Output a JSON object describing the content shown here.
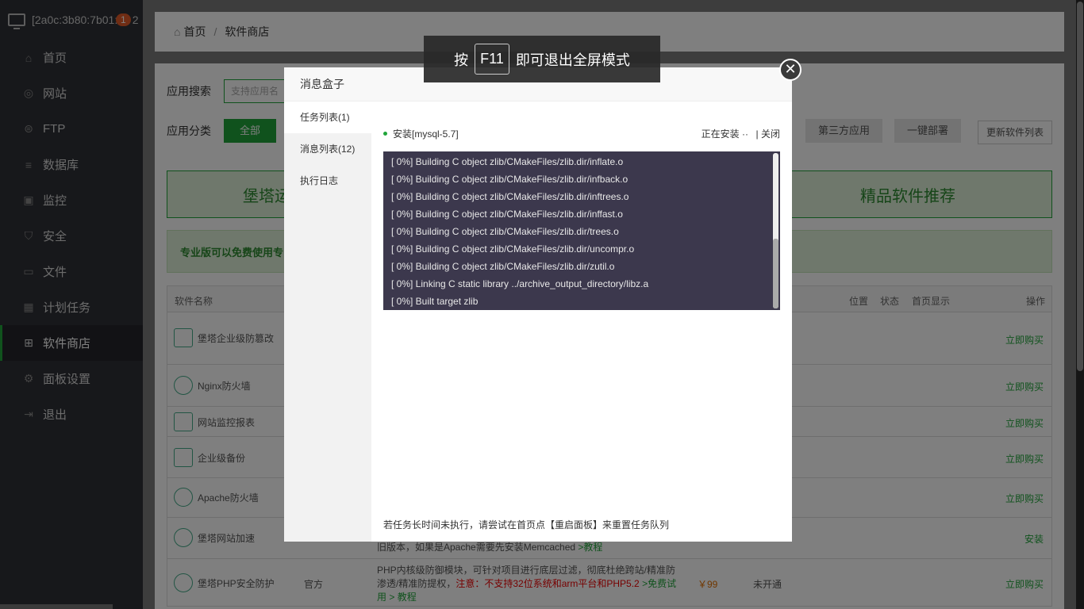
{
  "sidebar": {
    "server_name": "[2a0c:3b80:7b01:3",
    "server_suffix": "2",
    "notice_count": "1",
    "items": [
      {
        "label": "首页",
        "icon": "home-icon"
      },
      {
        "label": "网站",
        "icon": "globe-icon"
      },
      {
        "label": "FTP",
        "icon": "ftp-icon"
      },
      {
        "label": "数据库",
        "icon": "database-icon"
      },
      {
        "label": "监控",
        "icon": "monitor-icon"
      },
      {
        "label": "安全",
        "icon": "shield-icon"
      },
      {
        "label": "文件",
        "icon": "folder-icon"
      },
      {
        "label": "计划任务",
        "icon": "calendar-icon"
      },
      {
        "label": "软件商店",
        "icon": "grid-icon"
      },
      {
        "label": "面板设置",
        "icon": "gear-icon"
      },
      {
        "label": "退出",
        "icon": "logout-icon"
      }
    ]
  },
  "breadcrumb": {
    "home": "首页",
    "sep": "/",
    "current": "软件商店"
  },
  "store": {
    "search_label": "应用搜索",
    "search_placeholder": "支持应用名",
    "category_label": "应用分类",
    "category_all": "全部",
    "category_third": "第三方应用",
    "category_deploy": "一键部署",
    "update_btn": "更新软件列表",
    "banner_left": "堡塔运",
    "banner_right": "精品软件推荐",
    "tip": "专业版可以免费使用专"
  },
  "table": {
    "headers": {
      "name": "软件名称",
      "position": "位置",
      "status": "状态",
      "home": "首页显示",
      "op": "操作"
    },
    "rows": [
      {
        "name": "堡塔企业级防篡改",
        "op": "立即购买"
      },
      {
        "name": "Nginx防火墙",
        "op": "立即购买"
      },
      {
        "name": "网站监控报表",
        "op": "立即购买"
      },
      {
        "name": "企业级备份",
        "op": "立即购买"
      },
      {
        "name": "Apache防火墙",
        "op": "立即购买"
      },
      {
        "name": "堡塔网站加速",
        "op": "安装",
        "desc": "旧版本，如果是Apache需要先安装Memcached",
        "desc_link": ">教程"
      },
      {
        "name": "堡塔PHP安全防护",
        "op": "立即购买",
        "type": "官方",
        "desc1": "PHP内核级防御模块，可针对项目进行底层过滤，彻底杜绝跨站/精准防",
        "desc2": "渗透/精准防提权，",
        "warn": "注意：不支持32位系统和arm平台和PHP5.2",
        "link1": ">免费试",
        "desc3": "用",
        "link2": "> 教程",
        "price": "￥99",
        "expire": "未开通"
      }
    ]
  },
  "modal": {
    "title": "消息盒子",
    "tabs": [
      "任务列表(1)",
      "消息列表(12)",
      "执行日志"
    ],
    "task_name": "安装[mysql-5.7]",
    "task_status": "正在安装 ··",
    "task_close": "| 关闭",
    "log_lines": [
      "[ 0%] Building C object zlib/CMakeFiles/zlib.dir/inflate.o",
      "[ 0%] Building C object zlib/CMakeFiles/zlib.dir/infback.o",
      "[ 0%] Building C object zlib/CMakeFiles/zlib.dir/inftrees.o",
      "[ 0%] Building C object zlib/CMakeFiles/zlib.dir/inffast.o",
      "[ 0%] Building C object zlib/CMakeFiles/zlib.dir/trees.o",
      "[ 0%] Building C object zlib/CMakeFiles/zlib.dir/uncompr.o",
      "[ 0%] Building C object zlib/CMakeFiles/zlib.dir/zutil.o",
      "[ 0%] Linking C static library ../archive_output_directory/libz.a",
      "[ 0%] Built target zlib"
    ],
    "footer_note": "若任务长时间未执行，请尝试在首页点【重启面板】来重置任务队列",
    "close_symbol": "✕"
  },
  "fullscreen_hint": {
    "pre": "按",
    "key": "F11",
    "post": "即可退出全屏模式"
  },
  "colors": {
    "accent": "#20a53a",
    "sidebar_bg": "#2f3036",
    "log_bg": "#3c384d"
  }
}
